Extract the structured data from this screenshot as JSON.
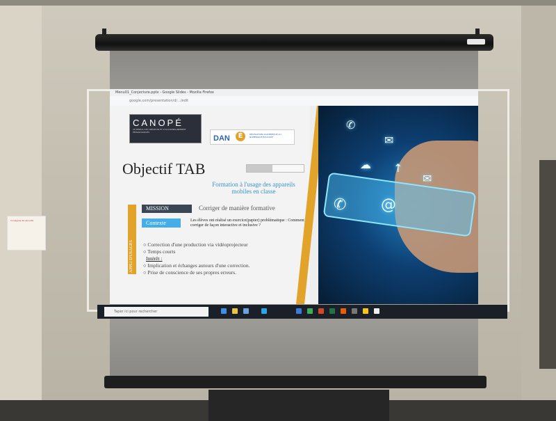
{
  "browser": {
    "title": "Menu01_Conjecture.pptx - Google Slides - Mozilla Firefox",
    "url": "google.com/presentation/d/.../edit"
  },
  "slide": {
    "logo_canope": "CANOPÉ",
    "logo_canope_sub": "LE RÉSEAU DE CRÉATION ET D'ACCOMPAGNEMENT PÉDAGOGIQUES",
    "logo_dan": "DAN",
    "logo_dan_e": "É",
    "logo_dan_sub": "DÉLÉGATION ACADÉMIQUE AU NUMÉRIQUE ÉDUCATIF",
    "title": "Objectif TAB",
    "progress_fraction": 0.45,
    "subtitle": "Formation à l'usage des appareils mobiles en classe",
    "mission_label": "MISSION",
    "mission_text": "Corriger de manière formative",
    "contexte_label": "Contexte",
    "contexte_text": "Les élèves ont réalisé un exercice(papier) problématique : Comment corriger de façon interactive et inclusive ?",
    "vertical_label": "APPLI D'USAGES",
    "bullets": [
      "○ Correction d'une production via vidéoprojecteur",
      "○ Temps courts"
    ],
    "interet_label": "Intérêt :",
    "interet_bullets": [
      "○ Implication et échanges autours d'une correction.",
      "○ Prise de conscience de ses propres erreurs."
    ]
  },
  "taskbar": {
    "search_placeholder": "Taper ici pour rechercher"
  },
  "poster": {
    "text": "Consignes de sécurité"
  },
  "colors": {
    "accent_gold": "#e2a32a",
    "mission_bg": "#3b4654",
    "contexte_bg": "#45aee8",
    "subtitle": "#3a93c8"
  }
}
